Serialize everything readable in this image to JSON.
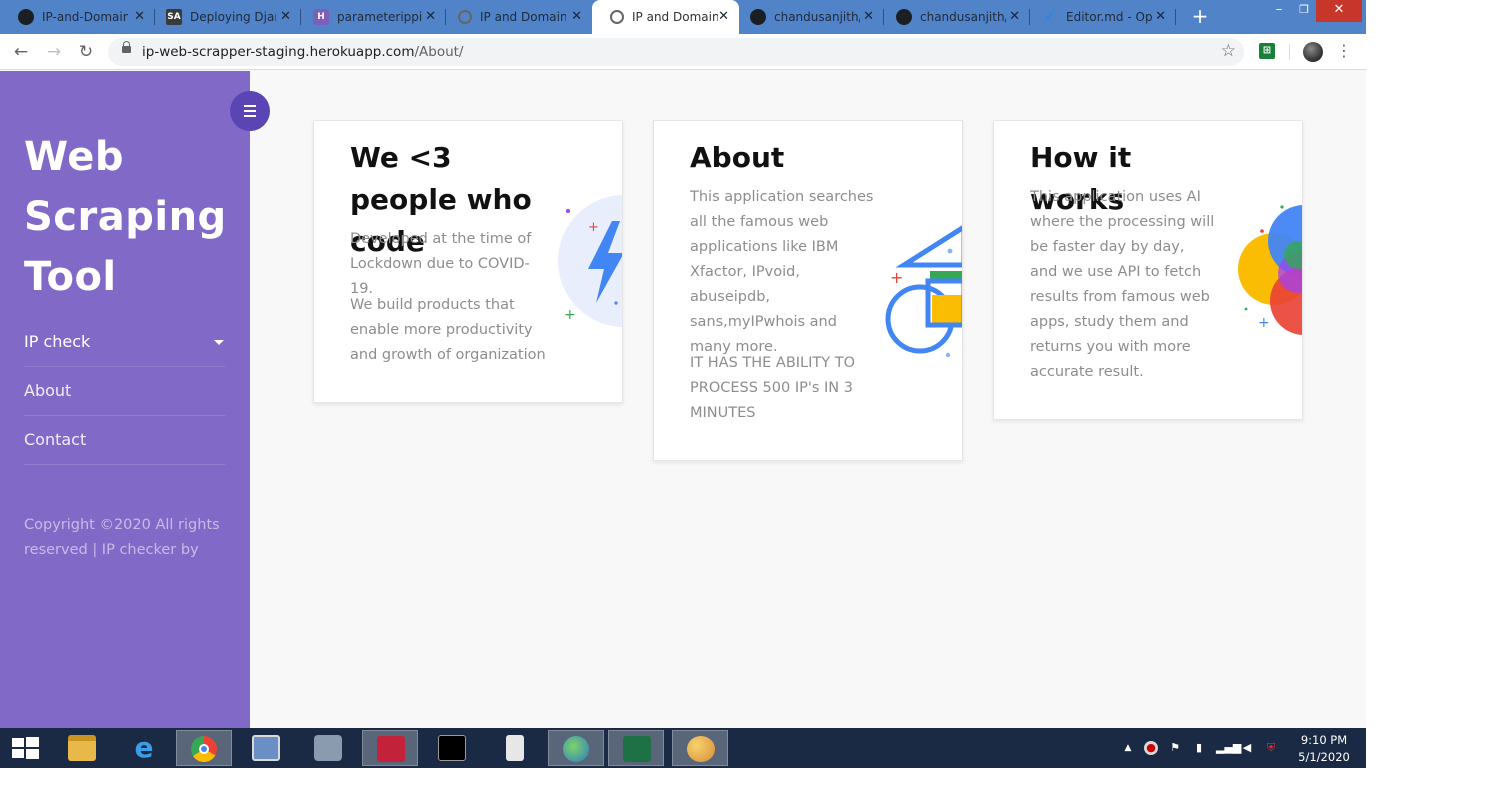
{
  "browser": {
    "tabs": [
      {
        "title": "IP-and-Domain",
        "favicon": "github-icon"
      },
      {
        "title": "Deploying Djan",
        "favicon": "sa-icon"
      },
      {
        "title": "parameterippip",
        "favicon": "heroku-icon"
      },
      {
        "title": "IP and Domain",
        "favicon": "globe-icon"
      },
      {
        "title": "IP and Domain",
        "favicon": "globe-icon"
      },
      {
        "title": "chandusanjith/",
        "favicon": "github-icon"
      },
      {
        "title": "chandusanjith/",
        "favicon": "github-icon"
      },
      {
        "title": "Editor.md - Op",
        "favicon": "markdown-icon"
      }
    ],
    "active_tab_index": 4,
    "close_glyph": "✕",
    "new_tab_glyph": "+",
    "url_domain": "ip-web-scrapper-staging.herokuapp.com",
    "url_path": "/About/"
  },
  "sidebar": {
    "brand": "Web Scraping Tool",
    "nav": [
      {
        "label": "IP check",
        "has_dropdown": true
      },
      {
        "label": "About",
        "has_dropdown": false
      },
      {
        "label": "Contact",
        "has_dropdown": false
      }
    ],
    "copyright": "Copyright ©2020 All rights reserved | IP checker by"
  },
  "cards": [
    {
      "title": "We <3 people who code",
      "paragraphs": [
        "Developed at the time of Lockdown due to COVID-19.",
        "We build products that enable more productivity and growth of organization"
      ]
    },
    {
      "title": "About",
      "paragraphs": [
        "This application searches all the famous web applications like IBM Xfactor, IPvoid, abuseipdb, sans,myIPwhois and many more.",
        "IT HAS THE ABILITY TO PROCESS 500 IP's IN 3 MINUTES"
      ]
    },
    {
      "title": "How it works",
      "paragraphs": [
        "This application uses AI where the processing will be faster day by day, and we use API to fetch results from famous web apps, study them and returns you with more accurate result."
      ]
    }
  ],
  "taskbar": {
    "apps": [
      "start-button",
      "file-explorer",
      "internet-explorer",
      "chrome",
      "network-tool",
      "security-tool",
      "notepad-tool",
      "command-prompt",
      "files",
      "globe-app",
      "excel",
      "paint"
    ],
    "time": "9:10 PM",
    "date": "5/1/2020"
  },
  "colors": {
    "sidebar": "#8069c7",
    "toggle": "#5b44b3",
    "tabbar": "#5183c9",
    "taskbar": "#1a2a44"
  }
}
